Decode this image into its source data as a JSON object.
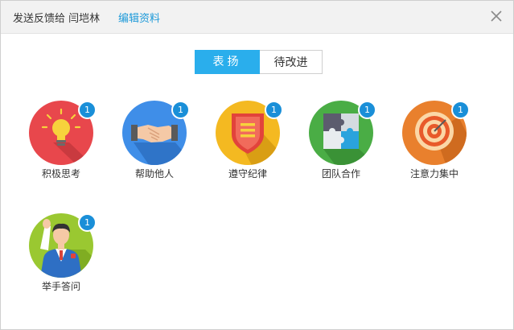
{
  "header": {
    "title": "发送反馈给 闫垲林",
    "edit_link": "编辑资料"
  },
  "tabs": [
    {
      "label": "表扬",
      "active": true
    },
    {
      "label": "待改进",
      "active": false
    }
  ],
  "badges": [
    {
      "label": "积极思考",
      "count": "1",
      "icon": "lightbulb-icon",
      "color": "#e8474c"
    },
    {
      "label": "帮助他人",
      "count": "1",
      "icon": "handshake-icon",
      "color": "#3f8ee8"
    },
    {
      "label": "遵守纪律",
      "count": "1",
      "icon": "shield-icon",
      "color": "#f4b921"
    },
    {
      "label": "团队合作",
      "count": "1",
      "icon": "puzzle-icon",
      "color": "#4aad45"
    },
    {
      "label": "注意力集中",
      "count": "1",
      "icon": "target-icon",
      "color": "#e9802d"
    },
    {
      "label": "举手答问",
      "count": "1",
      "icon": "raise-hand-icon",
      "color": "#9ac831"
    }
  ]
}
